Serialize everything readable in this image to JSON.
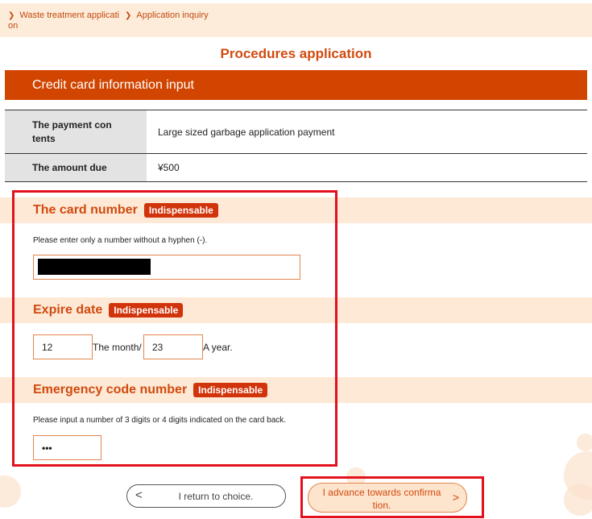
{
  "breadcrumb": {
    "item1": "Waste treatment applicati on",
    "item2": "Application inquiry",
    "chevron": "❯"
  },
  "page_title": "Procedures application",
  "section_header": "Credit card information input",
  "info": {
    "payment_contents_label": "The payment con tents",
    "payment_contents_value": "Large sized garbage application payment",
    "amount_due_label": "The amount due",
    "amount_due_value": "¥500"
  },
  "card_number": {
    "title": "The card number",
    "badge": "Indispensable",
    "hint": "Please enter only a number without a hyphen (-)."
  },
  "expire_date": {
    "title": "Expire date",
    "badge": "Indispensable",
    "month_value": "12",
    "month_label": "The month/",
    "year_value": "23",
    "year_label": "A year."
  },
  "emergency_code": {
    "title": "Emergency code number",
    "badge": "Indispensable",
    "hint": "Please input a number of 3 digits or 4 digits indicated on the card back.",
    "value": "•••"
  },
  "buttons": {
    "back_arrow": "<",
    "back_label": "I return to choice.",
    "next_label": "I advance towards confirma tion.",
    "next_arrow": ">"
  },
  "colors": {
    "accent": "#d14500",
    "band": "#fde9d6",
    "highlight": "#e3101e"
  }
}
